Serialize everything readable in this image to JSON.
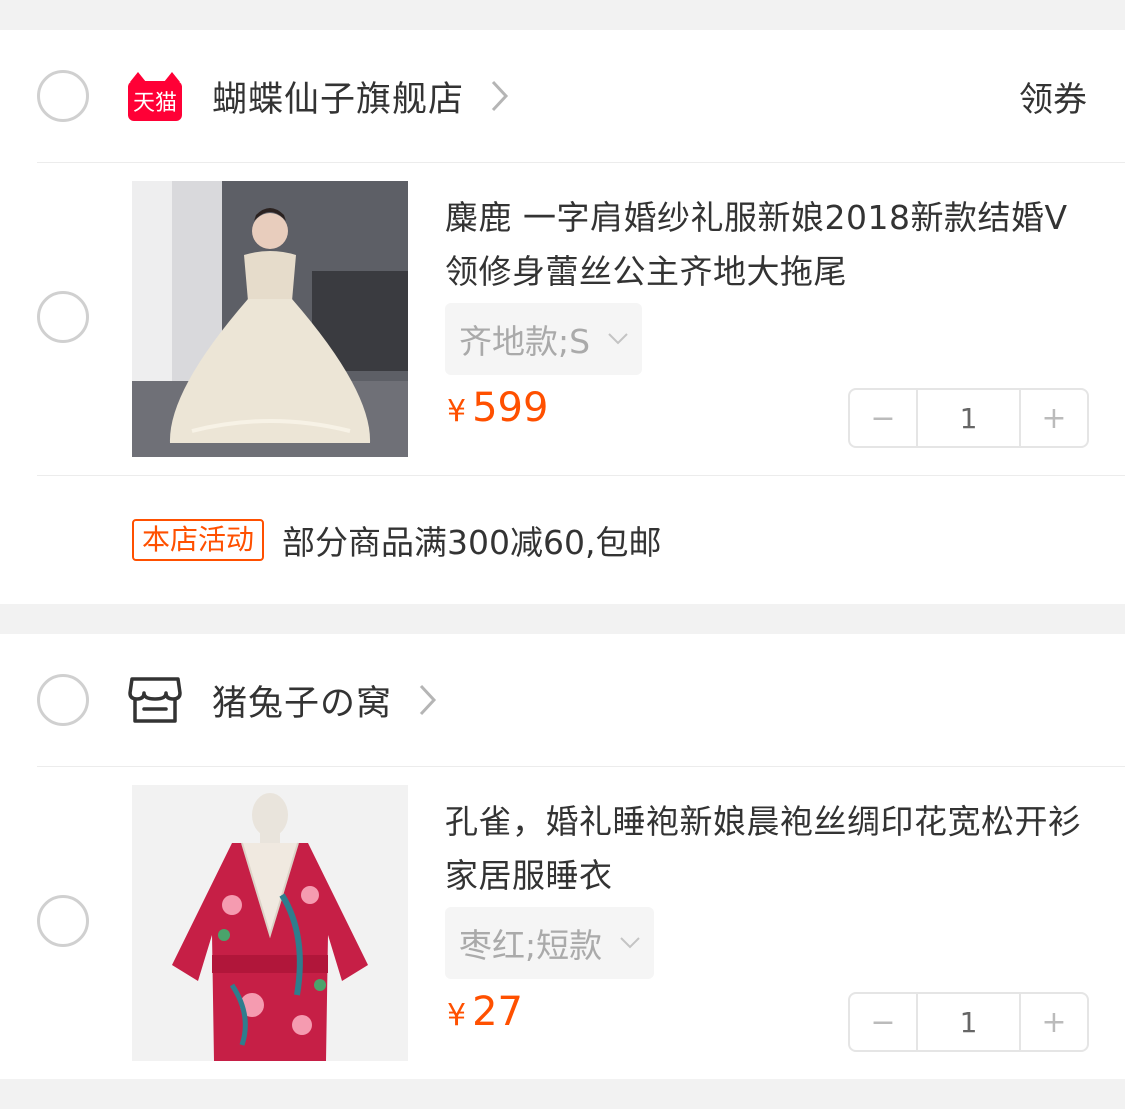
{
  "shops": [
    {
      "name": "蝴蝶仙子旗舰店",
      "icon": "tmall-icon",
      "icon_text": "天猫",
      "coupon": "领券",
      "items": [
        {
          "title": "麋鹿 一字肩婚纱礼服新娘2018新款结婚V领修身蕾丝公主齐地大拖尾",
          "spec": "齐地款;S",
          "currency": "¥",
          "price": "599",
          "quantity": "1"
        }
      ],
      "promo": {
        "tag": "本店活动",
        "text": "部分商品满300减60,包邮"
      }
    },
    {
      "name": "猪兔子の窝",
      "icon": "store-icon",
      "items": [
        {
          "title": "孔雀，婚礼睡袍新娘晨袍丝绸印花宽松开衫家居服睡衣",
          "spec": "枣红;短款",
          "currency": "¥",
          "price": "27",
          "quantity": "1"
        }
      ]
    }
  ],
  "stepper": {
    "minus": "−",
    "plus": "+"
  },
  "colors": {
    "accent": "#ff5000",
    "tmall": "#ff0036"
  }
}
